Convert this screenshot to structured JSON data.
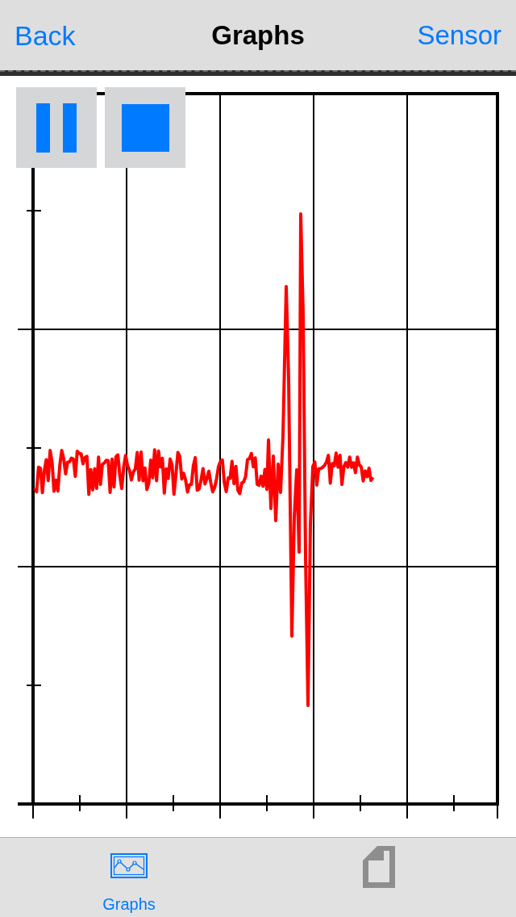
{
  "navigation_bar": {
    "back": "Back",
    "title": "Graphs",
    "action": "Sensor"
  },
  "tab_bar": {
    "tabs": [
      {
        "label": "Graphs",
        "selected": true
      },
      {
        "selected": false
      }
    ]
  }
}
